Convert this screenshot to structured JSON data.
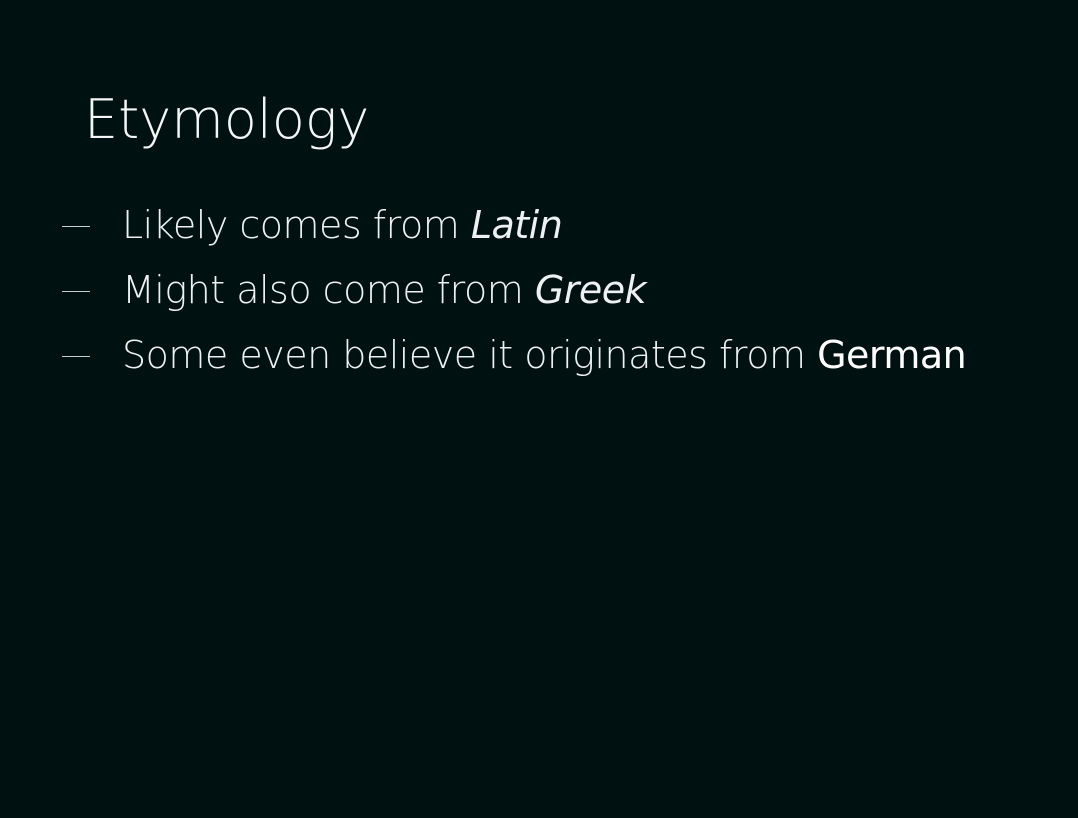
{
  "slide": {
    "title": "Etymology",
    "bullets": [
      {
        "text": "Likely comes from ",
        "emphasis": "Latin",
        "emphasis_style": "italic"
      },
      {
        "text": "Might also come from ",
        "emphasis": "Greek",
        "emphasis_style": "italic"
      },
      {
        "text": "Some even believe it originates from ",
        "emphasis": "German",
        "emphasis_style": "bold"
      }
    ]
  },
  "colors": {
    "background": "#001112",
    "text": "#eef1f1"
  }
}
